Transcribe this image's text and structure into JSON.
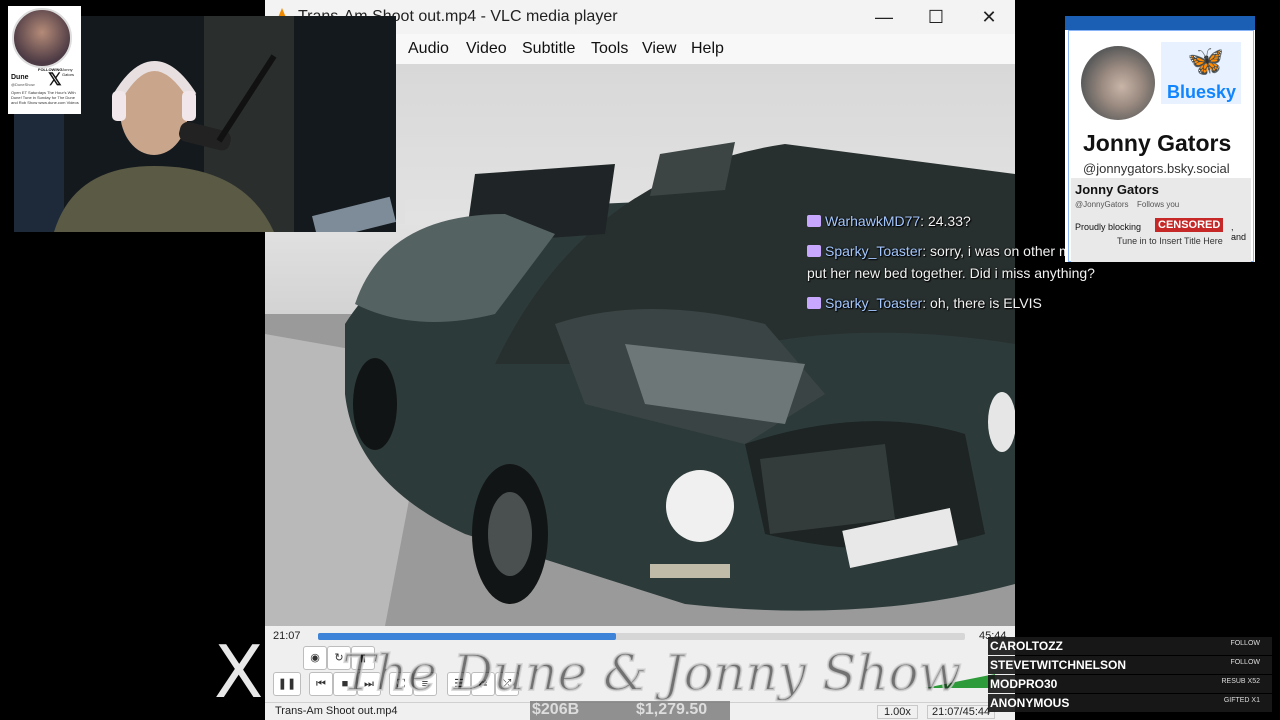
{
  "vlc": {
    "title": "Trans-Am Shoot out.mp4 - VLC media player",
    "menu": [
      "Audio",
      "Video",
      "Subtitle",
      "Tools",
      "View",
      "Help"
    ],
    "elapsed": "21:07",
    "duration": "45:44",
    "progress": 0.46,
    "status_file": "Trans-Am Shoot out.mp4",
    "speed": "1.00x",
    "status_time": "21:07/45:44"
  },
  "cam_card": {
    "name": "Dune",
    "handle": "@DuneShow",
    "following": "FOLLOWING",
    "tagline": "Jonny Gators",
    "bio": "Open ET Saturdays The Hour's With Dune! Tune in Sunday for The Dune and Rob Show www.dune.com Videos"
  },
  "chat": [
    {
      "user": "WarhawkMD77",
      "text": ": 24.33?"
    },
    {
      "user": "Sparky_Toaster",
      "text": ": sorry, i was on other monitor watching a korean",
      "cont": "put her new bed together. Did i miss anything?"
    },
    {
      "user": "Sparky_Toaster",
      "text": ": oh, there is ELVIS"
    }
  ],
  "bluesky": {
    "brand": "Bluesky",
    "name": "Jonny Gators",
    "handle": "@jonnygators.bsky.social",
    "profile_name": "Jonny Gators",
    "profile_handle": "@JonnyGators",
    "follows_you": "Follows you",
    "bio_start": "Proudly blocking",
    "censored": "CENSORED",
    "bio_end": ", and",
    "bio_line2": "Tune in to Insert Title Here"
  },
  "show": {
    "logo": "X",
    "title": "The Dune & Jonny Show",
    "stat1": "$206B",
    "stat2": "$1,279.50"
  },
  "events": [
    {
      "name": "CAROLTOZZ",
      "type": "FOLLOW"
    },
    {
      "name": "STEVETWITCHNELSON",
      "type": "FOLLOW"
    },
    {
      "name": "MODPRO30",
      "type": "RESUB X52"
    },
    {
      "name": "ANONYMOUS",
      "type": "GIFTED X1"
    }
  ],
  "colors": {
    "seek_fill": "#3d84d8",
    "bluesky": "#1185fe",
    "chat_user": "#a4c7ff",
    "censored": "#c62828"
  }
}
